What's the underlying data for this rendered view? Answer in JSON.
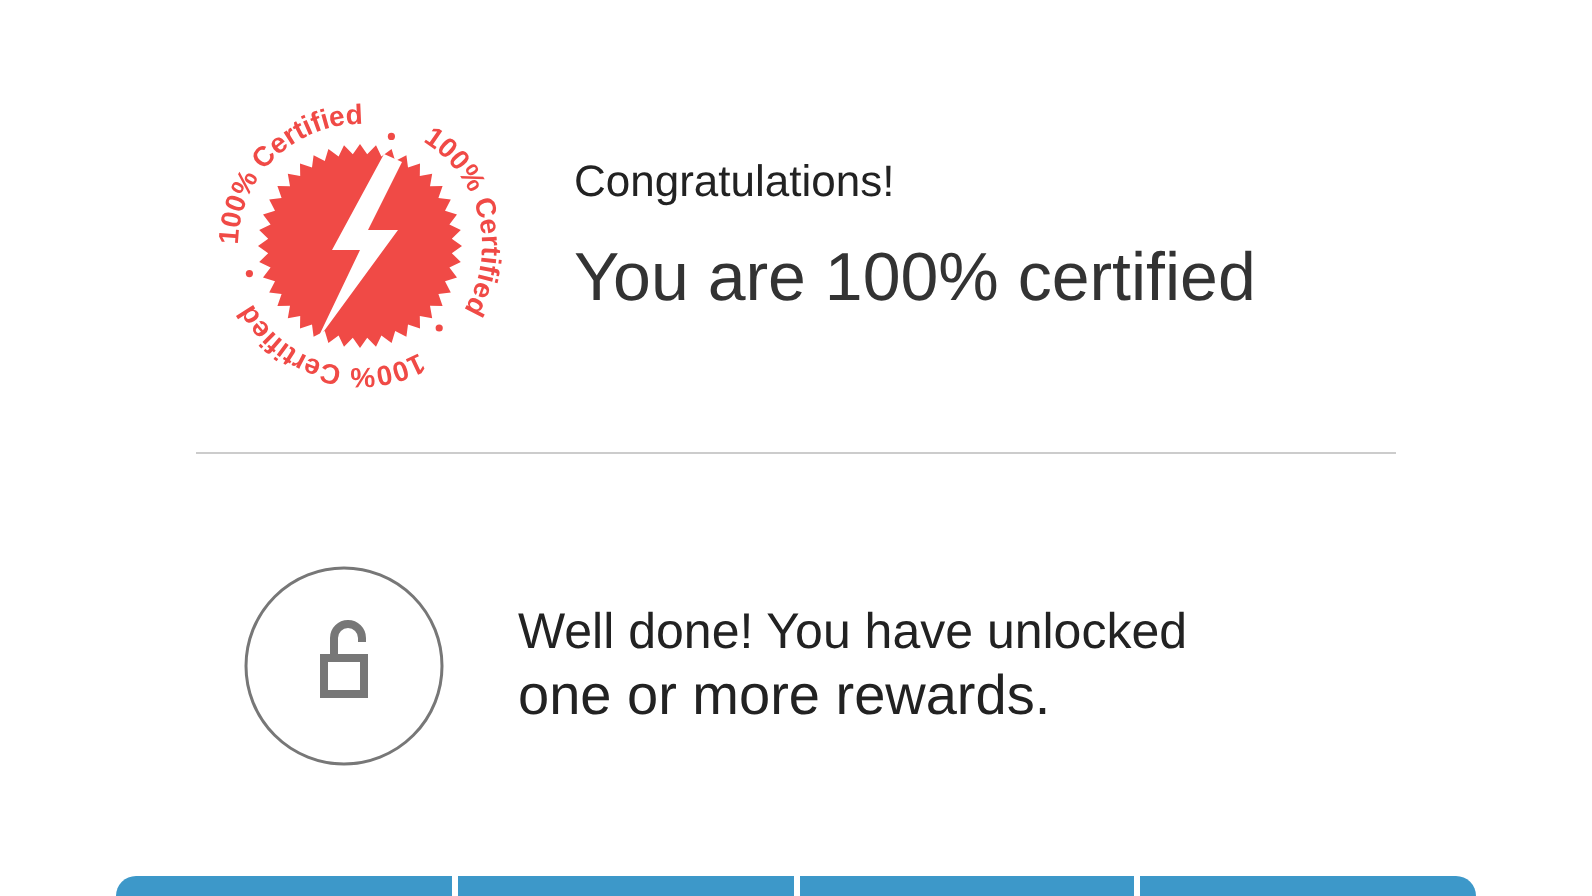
{
  "badge": {
    "ring_texts": [
      "100% Certified",
      "100% Certified",
      "100% Certified"
    ]
  },
  "heading": {
    "greeting": "Congratulations!",
    "title": "You are 100% certified"
  },
  "reward": {
    "line_1": "Well done! You have unlocked",
    "line_2": "one or more rewards."
  },
  "bottom_buttons": [
    {
      "kind": "button"
    },
    {
      "kind": "button"
    },
    {
      "kind": "button"
    },
    {
      "kind": "button"
    }
  ]
}
